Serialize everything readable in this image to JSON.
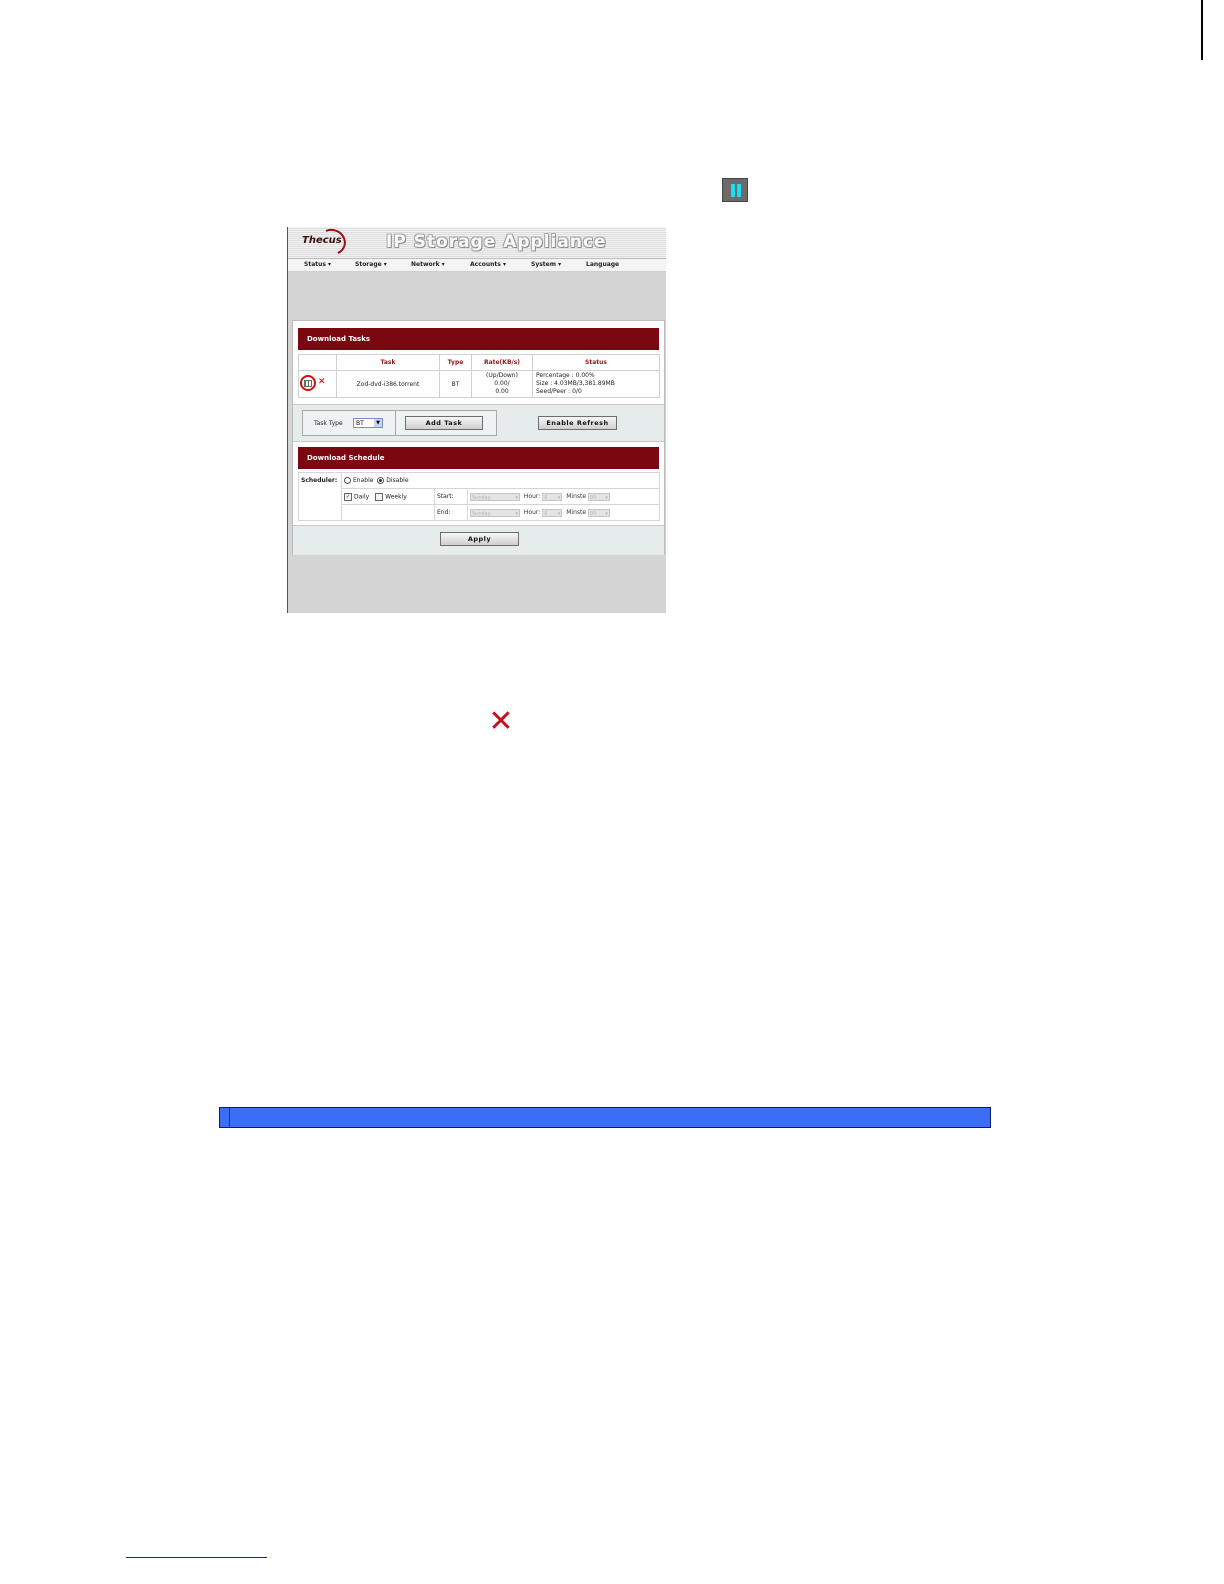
{
  "doc": {
    "pause_icon": "pause-icon",
    "delete_icon": "delete-x-icon"
  },
  "app": {
    "logo": "Thecus",
    "title": "IP Storage Appliance",
    "menu": [
      {
        "label": "Status ▾"
      },
      {
        "label": "Storage ▾"
      },
      {
        "label": "Network ▾"
      },
      {
        "label": "Accounts ▾"
      },
      {
        "label": "System ▾"
      },
      {
        "label": "Language"
      }
    ]
  },
  "download_tasks": {
    "header": "Download Tasks",
    "columns": [
      "",
      "Task",
      "Type",
      "Rate(KB/s)",
      "Status"
    ],
    "rows": [
      {
        "task": "Zod-dvd-i386.torrent",
        "type": "BT",
        "rate_line1": "(Up/Down)",
        "rate_line2": "0.00/",
        "rate_line3": "0.00",
        "status_line1": "Percentage : 0.00%",
        "status_line2": "Size : 4.03MB/3,381.89MB",
        "status_line3": "Seed/Peer : 0/0"
      }
    ],
    "task_type_label": "Task Type",
    "task_type_value": "BT",
    "add_task_label": "Add Task",
    "enable_refresh_label": "Enable Refresh"
  },
  "download_schedule": {
    "header": "Download Schedule",
    "scheduler_label": "Scheduler:",
    "enable_label": "Enable",
    "disable_label": "Disable",
    "selected": "Disable",
    "daily_label": "Daily",
    "weekly_label": "Weekly",
    "start_label": "Start:",
    "end_label": "End:",
    "day_value": "Sunday",
    "hour_label": "Hour:",
    "hour_value": "0",
    "minute_label": "Minste",
    "minute_value": "00",
    "apply_label": "Apply"
  }
}
